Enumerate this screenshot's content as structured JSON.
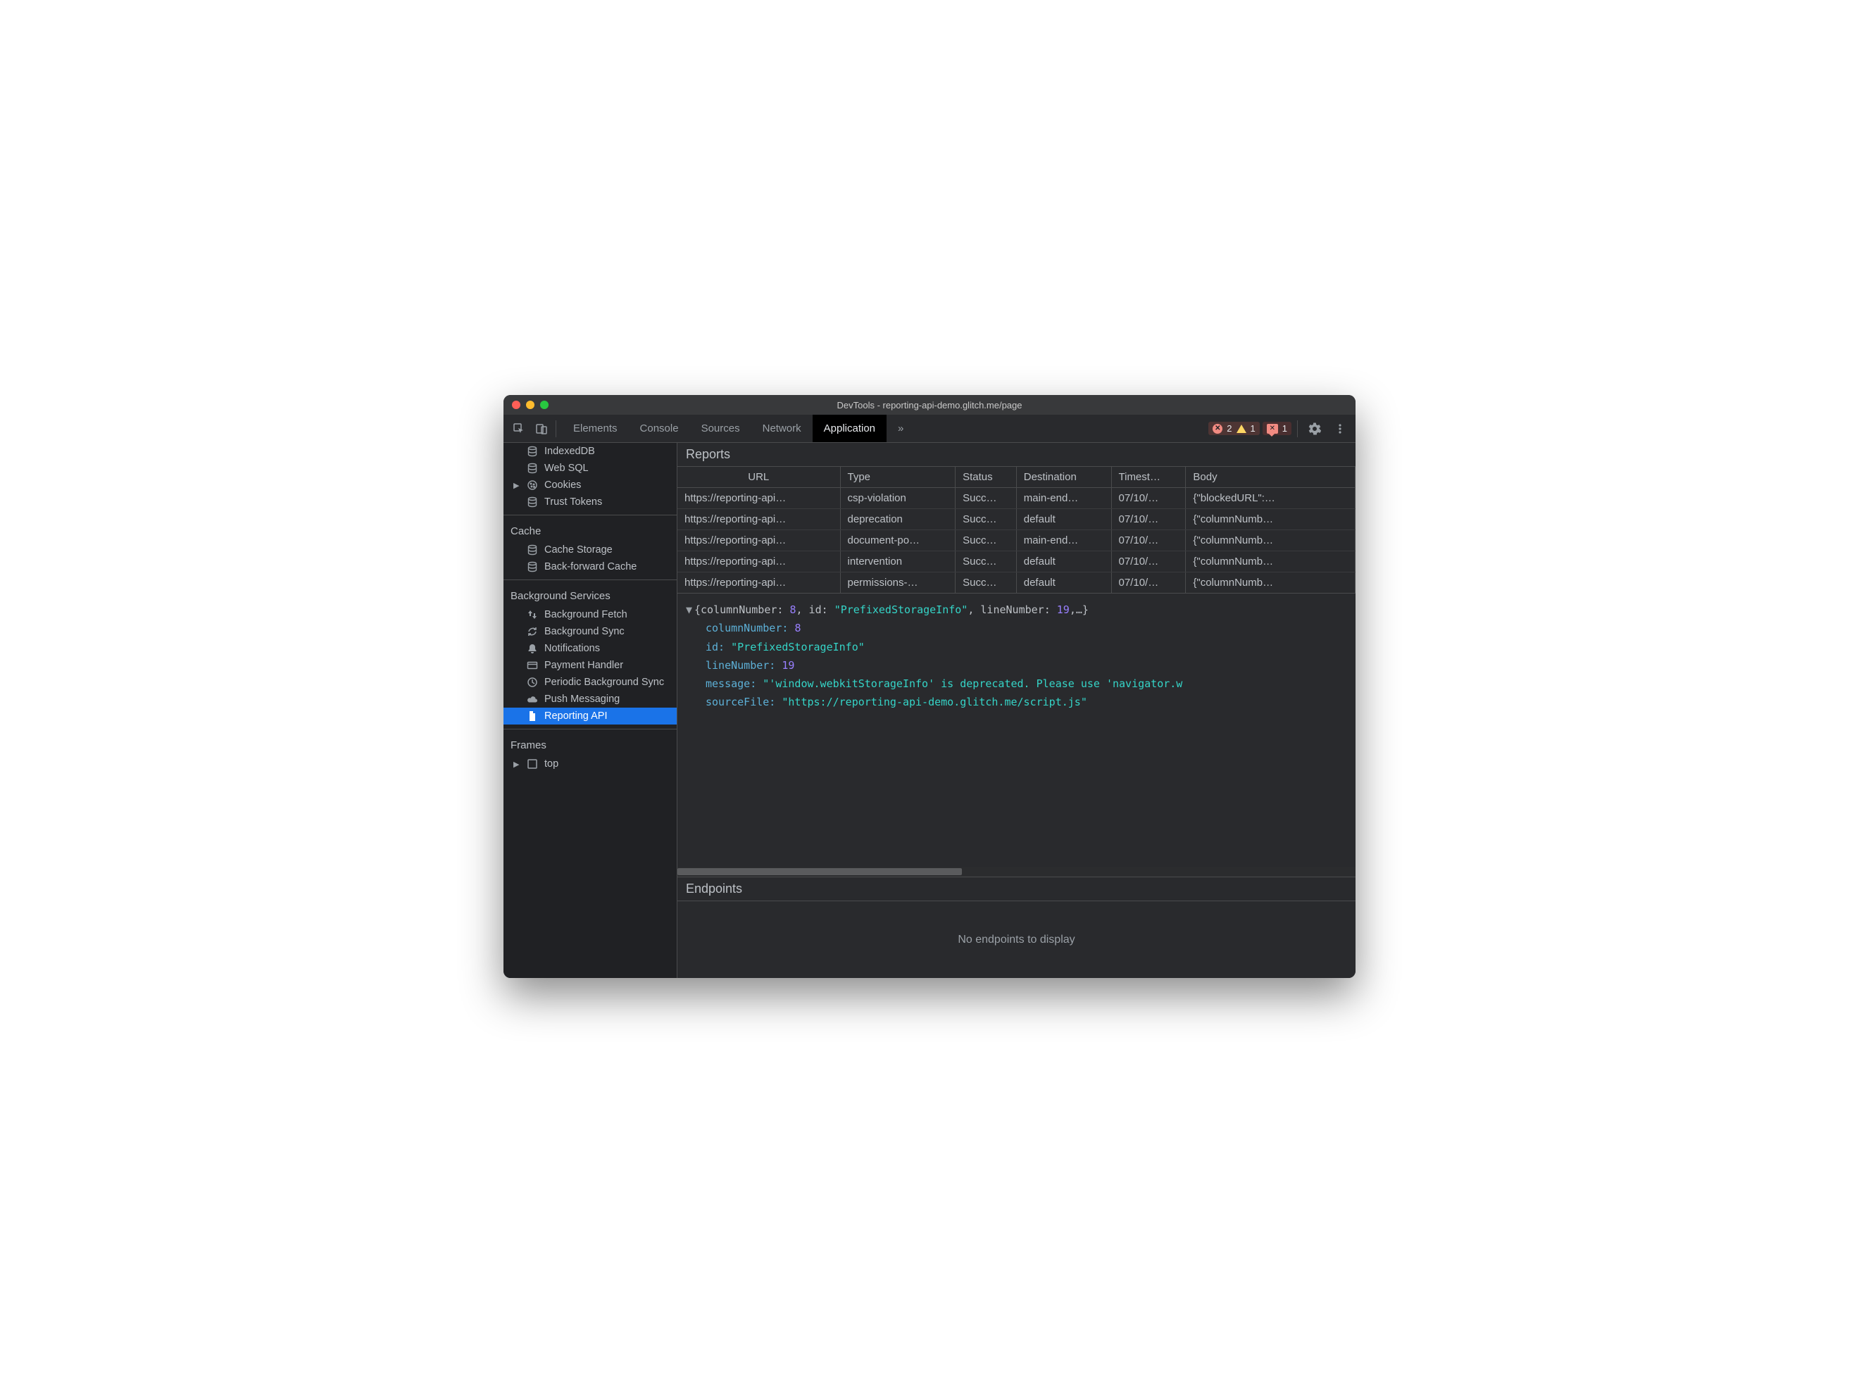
{
  "window": {
    "title": "DevTools - reporting-api-demo.glitch.me/page"
  },
  "toolbar": {
    "tabs": [
      "Elements",
      "Console",
      "Sources",
      "Network",
      "Application"
    ],
    "active_tab": "Application",
    "overflow_glyph": "»",
    "errors_count": "2",
    "warnings_count": "1",
    "issues_count": "1"
  },
  "sidebar": {
    "storage_items": [
      {
        "icon": "db",
        "label": "IndexedDB",
        "expandable": false
      },
      {
        "icon": "db",
        "label": "Web SQL",
        "expandable": false
      },
      {
        "icon": "cookie",
        "label": "Cookies",
        "expandable": true
      },
      {
        "icon": "db",
        "label": "Trust Tokens",
        "expandable": false
      }
    ],
    "groups": [
      {
        "title": "Cache",
        "items": [
          {
            "icon": "db",
            "label": "Cache Storage"
          },
          {
            "icon": "db",
            "label": "Back-forward Cache"
          }
        ]
      },
      {
        "title": "Background Services",
        "items": [
          {
            "icon": "updown",
            "label": "Background Fetch"
          },
          {
            "icon": "sync",
            "label": "Background Sync"
          },
          {
            "icon": "bell",
            "label": "Notifications"
          },
          {
            "icon": "card",
            "label": "Payment Handler"
          },
          {
            "icon": "clock",
            "label": "Periodic Background Sync"
          },
          {
            "icon": "cloud",
            "label": "Push Messaging"
          },
          {
            "icon": "file",
            "label": "Reporting API",
            "selected": true
          }
        ]
      },
      {
        "title": "Frames",
        "items": [
          {
            "icon": "frame",
            "label": "top",
            "expandable": true
          }
        ]
      }
    ]
  },
  "reports": {
    "header": "Reports",
    "columns": [
      "URL",
      "Type",
      "Status",
      "Destination",
      "Timest…",
      "Body"
    ],
    "rows": [
      {
        "url": "https://reporting-api…",
        "type": "csp-violation",
        "status": "Succ…",
        "dest": "main-end…",
        "ts": "07/10/…",
        "body": "{\"blockedURL\":…"
      },
      {
        "url": "https://reporting-api…",
        "type": "deprecation",
        "status": "Succ…",
        "dest": "default",
        "ts": "07/10/…",
        "body": "{\"columnNumb…"
      },
      {
        "url": "https://reporting-api…",
        "type": "document-po…",
        "status": "Succ…",
        "dest": "main-end…",
        "ts": "07/10/…",
        "body": "{\"columnNumb…"
      },
      {
        "url": "https://reporting-api…",
        "type": "intervention",
        "status": "Succ…",
        "dest": "default",
        "ts": "07/10/…",
        "body": "{\"columnNumb…"
      },
      {
        "url": "https://reporting-api…",
        "type": "permissions-…",
        "status": "Succ…",
        "dest": "default",
        "ts": "07/10/…",
        "body": "{\"columnNumb…"
      }
    ]
  },
  "detail": {
    "summary_prefix": "{columnNumber: ",
    "summary_col": "8",
    "summary_mid1": ", id: ",
    "summary_id": "\"PrefixedStorageInfo\"",
    "summary_mid2": ", lineNumber: ",
    "summary_line": "19",
    "summary_suffix": ",…}",
    "props": {
      "columnNumber_key": "columnNumber:",
      "columnNumber_val": "8",
      "id_key": "id:",
      "id_val": "\"PrefixedStorageInfo\"",
      "lineNumber_key": "lineNumber:",
      "lineNumber_val": "19",
      "message_key": "message:",
      "message_val": "\"'window.webkitStorageInfo' is deprecated. Please use 'navigator.w",
      "sourceFile_key": "sourceFile:",
      "sourceFile_val": "\"https://reporting-api-demo.glitch.me/script.js\""
    }
  },
  "endpoints": {
    "header": "Endpoints",
    "empty": "No endpoints to display"
  }
}
